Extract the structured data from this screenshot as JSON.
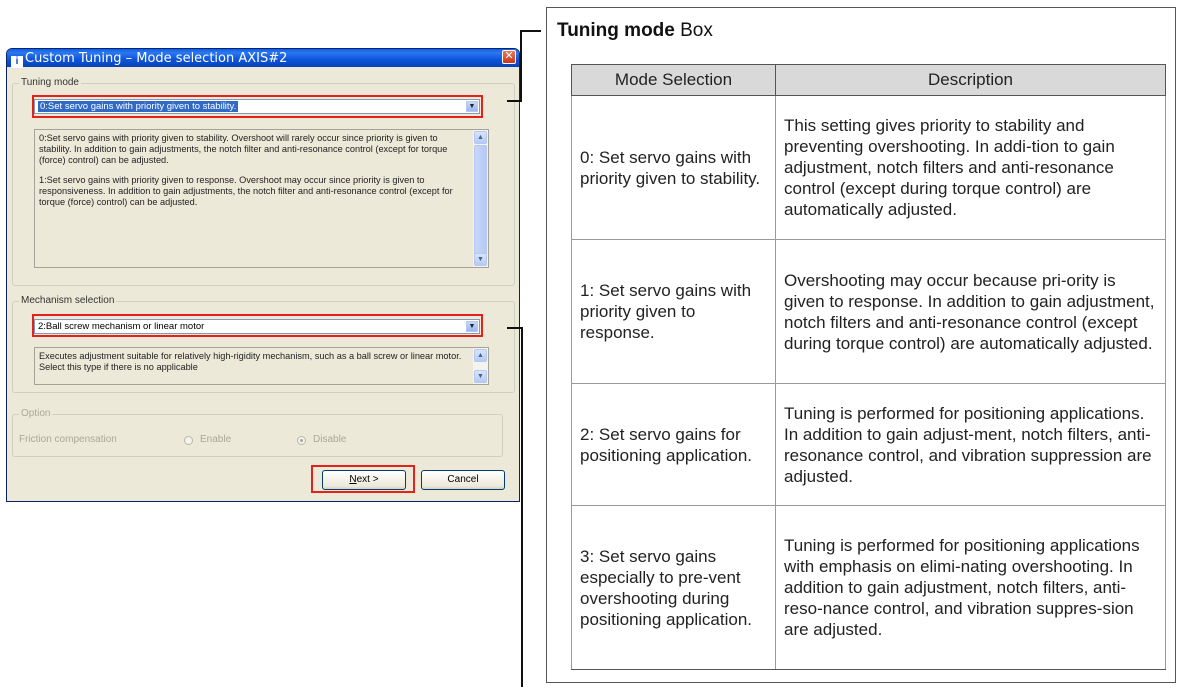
{
  "dialog": {
    "title": "Custom Tuning – Mode selection AXIS#2",
    "icon_name": "app-icon",
    "close_icon": "close-icon",
    "tuning_mode": {
      "label": "Tuning mode",
      "selected": "0:Set servo gains with priority given to stability.",
      "description": [
        "0:Set servo gains with priority given to stability. Overshoot will rarely occur since priority is given to stability. In addition to gain adjustments, the notch filter and anti-resonance control (except for torque (force) control) can be adjusted.",
        "1:Set servo gains with priority given to response. Overshoot may occur since priority is given to responsiveness. In addition to gain adjustments, the notch filter and anti-resonance control (except for torque (force) control) can be adjusted."
      ]
    },
    "mechanism": {
      "label": "Mechanism selection",
      "selected": "2:Ball screw mechanism or linear motor",
      "description": "Executes adjustment suitable for relatively high-rigidity mechanism, such as a ball screw or linear motor. Select this type if there is no applicable"
    },
    "option": {
      "label": "Option",
      "friction_label": "Friction compensation",
      "enable_label": "Enable",
      "disable_label": "Disable",
      "selected": "Disable"
    },
    "buttons": {
      "next_mnemonic": "N",
      "next_rest": "ext >",
      "cancel": "Cancel"
    },
    "highlight_color": "#e3231b"
  },
  "panel": {
    "title_bold": "Tuning mode",
    "title_rest": " Box",
    "headers": [
      "Mode Selection",
      "Description"
    ],
    "rows": [
      {
        "mode": "0: Set servo gains with priority given to stability.",
        "description": "This setting gives priority to stability and preventing overshooting. In addi-tion to gain adjustment, notch filters and anti-resonance control (except during torque control) are automatically adjusted."
      },
      {
        "mode": "1: Set servo gains with priority given to response.",
        "description": "Overshooting may occur because pri-ority is given to response. In addition to gain adjustment, notch filters and anti-resonance control (except during torque control) are automatically adjusted."
      },
      {
        "mode": "2: Set servo gains for positioning application.",
        "description": "Tuning is performed for positioning applications. In addition to gain adjust-ment, notch filters, anti-resonance control, and vibration suppression are adjusted."
      },
      {
        "mode": "3: Set servo gains especially to pre-vent overshooting during positioning application.",
        "description": "Tuning is performed for positioning applications with emphasis on elimi-nating overshooting. In addition to gain adjustment, notch filters, anti-reso-nance control, and vibration suppres-sion are adjusted."
      }
    ]
  }
}
